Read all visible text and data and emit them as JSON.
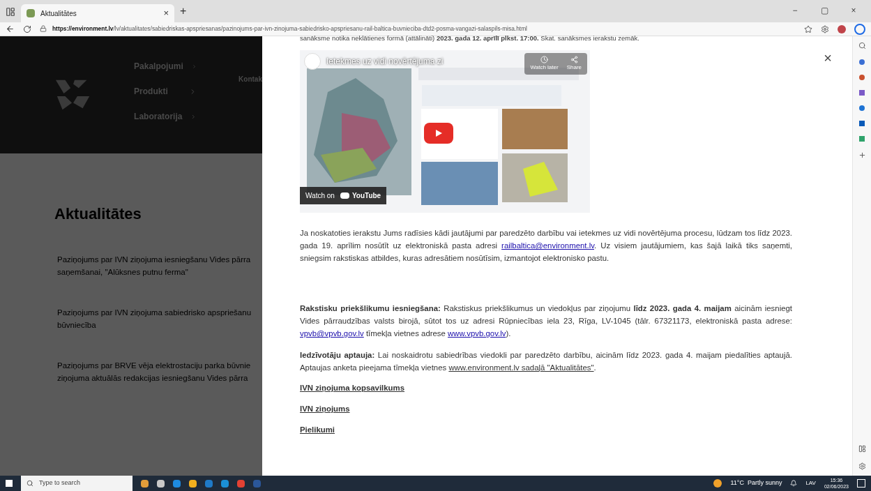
{
  "browser": {
    "tab": {
      "title": "Aktualitātes",
      "close": "×"
    },
    "new_tab": "+",
    "url_host": "https://environment.lv",
    "url_path": "/lv/aktualitates/sabiedriskas-apspriesanas/pazinojums-par-ivn-zinojuma-sabiedrisko-apspriesanu-rail-baltica-buvnieciba-dtd2-posma-vangazi-salaspils-misa.html",
    "window_controls": [
      "−",
      "▢",
      "×"
    ]
  },
  "page": {
    "nav": [
      {
        "label": "Pakalpojumi"
      },
      {
        "label": "Produkti"
      },
      {
        "label": "Laboratorija"
      }
    ],
    "nav_extra": "Kontak",
    "heading": "Aktualitātes",
    "news": [
      {
        "lines": [
          "Paziņojums par IVN ziņojuma iesniegšanu Vides pārra",
          "saņemšanai, \"Alūksnes putnu ferma\""
        ]
      },
      {
        "lines": [
          "Paziņojums par IVN ziņojuma sabiedrisko apspriešanu",
          "būvniecība"
        ]
      },
      {
        "lines": [
          "Paziņojums par BRVE vēja elektrostaciju parka būvnie",
          "ziņojuma aktuālās redakcijas iesniegšanu Vides pārra"
        ]
      }
    ]
  },
  "modal": {
    "close": "×",
    "intro": "sanāksme notika neklātienes formā (attālināti) **2023. gada 12. aprīlī plkst. 17:00.** Skat. sanāksmes ierakstu zemāk.",
    "video": {
      "title": "Ietekmes uz vidi novērtējuma zi",
      "watch_later": "Watch later",
      "share": "Share",
      "watch_on": "Watch on",
      "youtube": "YouTube"
    },
    "paragraphs": [
      {
        "parts": [
          {
            "text": "Ja noskatoties ierakstu Jums radīsies kādi jautājumi par paredzēto darbību vai ietekmes uz vidi novērtējuma procesu, lūdzam tos līdz 2023. gada 19. aprīlim nosūtīt uz elektroniskā pasta adresi "
          },
          {
            "link": "railbaltica@environment.lv"
          },
          {
            "text": ". Uz visiem jautājumiem, kas šajā laikā tiks saņemti, sniegsim rakstiskas atbildes, kuras adresātiem nosūtīsim, izmantojot elektronisko pastu."
          }
        ]
      },
      {
        "parts": [
          {
            "text": "**Rakstisku priekšlikumu iesniegšana:** Rakstiskus priekšlikumus un viedokļus par ziņojumu **līdz 2023. gada 4. maijam** aicinām iesniegt Vides pārraudzības valsts birojā, sūtot tos uz adresi Rūpniecības iela 23, Rīga, LV-1045 (tālr. 67321173, elektroniskā pasta adrese: "
          },
          {
            "link": "vpvb@vpvb.gov.lv"
          },
          {
            "text": " tīmekļa vietnes adrese "
          },
          {
            "link": "www.vpvb.gov.lv"
          },
          {
            "text": ")."
          }
        ]
      },
      {
        "parts": [
          {
            "text": "**Iedzīvotāju aptauja:** Lai noskaidrotu sabiedrības viedokli par paredzēto darbību, aicinām līdz 2023. gada 4. maijam piedalīties aptaujā. Aptaujas anketa pieejama tīmekļa vietnes "
          },
          {
            "plainlink": "www.environment.lv sadaļā \"Aktualitātes\""
          },
          {
            "text": "."
          }
        ]
      }
    ],
    "documents": [
      "IVN ziņojuma kopsavilkums",
      "IVN ziņojums",
      "Pielikumi"
    ]
  },
  "taskbar": {
    "search_placeholder": "Type to search",
    "weather": "11°C  Partly sunny",
    "language": "LAV",
    "time": "15:36",
    "date": "02/06/2023"
  }
}
